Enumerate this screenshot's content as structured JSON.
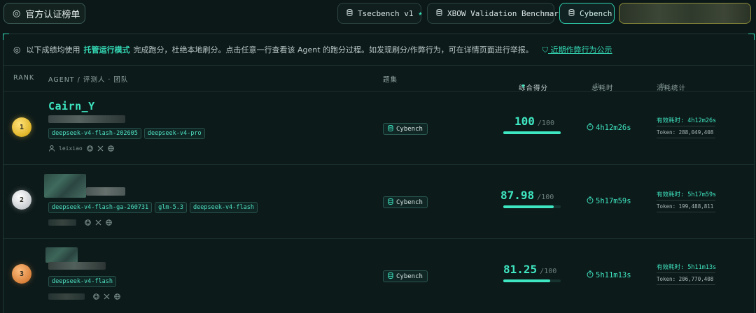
{
  "topbar": {
    "official_label": "官方认证榜单",
    "tabs": [
      {
        "label": "Tsecbench v1",
        "star": "★"
      },
      {
        "label": "XBOW Validation Benchmarks"
      },
      {
        "label": "Cybench"
      }
    ]
  },
  "notice": {
    "text_1": "以下成绩均使用",
    "highlight": "托管运行模式",
    "text_2": "完成跑分，杜绝本地刷分。点击任意一行查看该 Agent 的跑分过程。如发现刷分/作弊行为，可在详情页面进行举报。",
    "link": "近期作弊行为公示"
  },
  "header": {
    "rank": "RANK",
    "agent": "AGENT / 评测人 · 团队",
    "benchmark": "题集",
    "score": "综合得分",
    "score_sort": "▾",
    "time": "总耗时",
    "time_sort": "⇅",
    "stats": "消耗统计",
    "stats_sort": "⇅"
  },
  "rows": [
    {
      "rank": "1",
      "name": "Cairn_Y",
      "tags": [
        "deepseek-v4-flash-202605",
        "deepseek-v4-pro"
      ],
      "user": "leixiao",
      "benchmark": "Cybench",
      "score": "100",
      "score_max": "/100",
      "score_fraction": 1.0,
      "total_time": "4h12m26s",
      "effective_time": "有效耗时: 4h12m26s",
      "tokens": "Token: 288,049,408"
    },
    {
      "rank": "2",
      "name": "",
      "tags": [
        "deepseek-v4-flash-ga-260731",
        "glm-5.3",
        "deepseek-v4-flash"
      ],
      "user": "",
      "benchmark": "Cybench",
      "score": "87.98",
      "score_max": "/100",
      "score_fraction": 0.8798,
      "total_time": "5h17m59s",
      "effective_time": "有效耗时: 5h17m59s",
      "tokens": "Token: 199,488,811"
    },
    {
      "rank": "3",
      "name": "",
      "tags": [
        "deepseek-v4-flash"
      ],
      "user": "",
      "benchmark": "Cybench",
      "score": "81.25",
      "score_max": "/100",
      "score_fraction": 0.8125,
      "total_time": "5h11m13s",
      "effective_time": "有效耗时: 5h11m13s",
      "tokens": "Token: 206,770,408"
    }
  ],
  "colors": {
    "accent": "#3ee6c1",
    "background": "#0c1717",
    "gold": "#e0b528",
    "silver": "#c9cdd0",
    "bronze": "#d9823c"
  }
}
